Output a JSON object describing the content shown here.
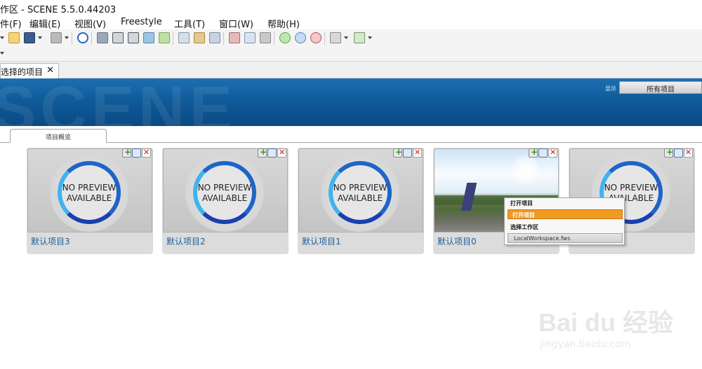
{
  "window": {
    "title": "作区 - SCENE 5.5.0.44203"
  },
  "menu": [
    "件(F)",
    "编辑(E)",
    "视图(V)",
    "Freestyle",
    "工具(T)",
    "窗口(W)",
    "帮助(H)"
  ],
  "toolbar_icons": [
    "open-icon",
    "save-icon",
    "print-icon",
    "help-icon",
    "scan-icon",
    "3d-view-icon",
    "1-2-icon",
    "home-icon",
    "image-icon",
    "layout-icon",
    "refresh-icon",
    "download-icon",
    "window-icon",
    "page-icon",
    "stack-icon",
    "cloud-green-icon",
    "cloud-blue-icon",
    "cloud-red-icon",
    "record-icon",
    "export-icon"
  ],
  "document_tab": {
    "label": "选择的项目",
    "close": "✕"
  },
  "banner": {
    "watermark": "SCENE",
    "label": "显示",
    "all_projects_button": "所有项目"
  },
  "subtab": {
    "label": "项目概览"
  },
  "projects": [
    {
      "name": "默认项目3",
      "preview": "NO PREVIEW\nAVAILABLE",
      "has_photo": false
    },
    {
      "name": "默认项目2",
      "preview": "NO PREVIEW\nAVAILABLE",
      "has_photo": false
    },
    {
      "name": "默认项目1",
      "preview": "NO PREVIEW\nAVAILABLE",
      "has_photo": false
    },
    {
      "name": "默认项目0",
      "preview": "",
      "has_photo": true
    },
    {
      "name": "",
      "preview": "NO PREVIEW\nAVAILABLE",
      "has_photo": false
    }
  ],
  "context_menu": {
    "header_open": "打开项目",
    "open_item": "打开项目",
    "header_workspace": "选择工作区",
    "workspace_item": "LocalWorkspace.fws"
  },
  "watermark": {
    "brand": "Bai du 经验",
    "url": "jingyan.baidu.com"
  },
  "colors": {
    "banner": "#0f5b9a",
    "link": "#1d5f9c",
    "menu_highlight": "#f09a22"
  }
}
